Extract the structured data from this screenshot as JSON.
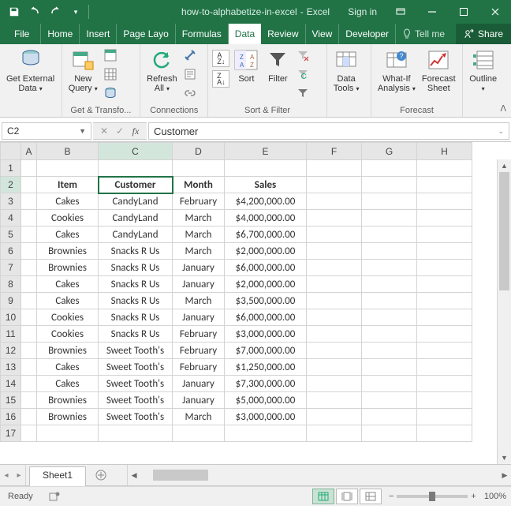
{
  "title": {
    "filename": "how-to-alphabetize-in-excel",
    "app": "Excel",
    "signin": "Sign in"
  },
  "tabs": {
    "list": [
      "File",
      "Home",
      "Insert",
      "Page Layo",
      "Formulas",
      "Data",
      "Review",
      "View",
      "Developer"
    ],
    "active": "Data",
    "tellme": "Tell me",
    "share": "Share"
  },
  "ribbon": {
    "groups": [
      {
        "label": "",
        "big": [
          {
            "name": "get-external-data",
            "text": "Get External\nData"
          }
        ]
      },
      {
        "label": "Get & Transfo...",
        "big": [
          {
            "name": "new-query",
            "text": "New\nQuery"
          }
        ],
        "smalls": 3
      },
      {
        "label": "Connections",
        "big": [
          {
            "name": "refresh-all",
            "text": "Refresh\nAll"
          }
        ],
        "smalls": 3
      },
      {
        "label": "Sort & Filter",
        "big": [
          {
            "name": "sort",
            "text": "Sort"
          },
          {
            "name": "filter",
            "text": "Filter"
          }
        ],
        "sortAZ": true,
        "filterSmalls": 3
      },
      {
        "label": "",
        "big": [
          {
            "name": "data-tools",
            "text": "Data\nTools"
          }
        ]
      },
      {
        "label": "Forecast",
        "big": [
          {
            "name": "what-if-analysis",
            "text": "What-If\nAnalysis"
          },
          {
            "name": "forecast-sheet",
            "text": "Forecast\nSheet"
          }
        ]
      },
      {
        "label": "",
        "big": [
          {
            "name": "outline",
            "text": "Outline"
          }
        ]
      }
    ]
  },
  "namebox": "C2",
  "formula": "Customer",
  "columns": [
    "A",
    "B",
    "C",
    "D",
    "E",
    "F",
    "G",
    "H"
  ],
  "activeCell": {
    "row": 2,
    "col": "C"
  },
  "headersRow": {
    "B": "Item",
    "C": "Customer",
    "D": "Month",
    "E": "Sales"
  },
  "rows": [
    {
      "n": 1
    },
    {
      "n": 2,
      "headers": true
    },
    {
      "n": 3,
      "B": "Cakes",
      "C": "CandyLand",
      "D": "February",
      "E": "$4,200,000.00"
    },
    {
      "n": 4,
      "B": "Cookies",
      "C": "CandyLand",
      "D": "March",
      "E": "$4,000,000.00"
    },
    {
      "n": 5,
      "B": "Cakes",
      "C": "CandyLand",
      "D": "March",
      "E": "$6,700,000.00"
    },
    {
      "n": 6,
      "B": "Brownies",
      "C": "Snacks R Us",
      "D": "March",
      "E": "$2,000,000.00"
    },
    {
      "n": 7,
      "B": "Brownies",
      "C": "Snacks R Us",
      "D": "January",
      "E": "$6,000,000.00"
    },
    {
      "n": 8,
      "B": "Cakes",
      "C": "Snacks R Us",
      "D": "January",
      "E": "$2,000,000.00"
    },
    {
      "n": 9,
      "B": "Cakes",
      "C": "Snacks R Us",
      "D": "March",
      "E": "$3,500,000.00"
    },
    {
      "n": 10,
      "B": "Cookies",
      "C": "Snacks R Us",
      "D": "January",
      "E": "$6,000,000.00"
    },
    {
      "n": 11,
      "B": "Cookies",
      "C": "Snacks R Us",
      "D": "February",
      "E": "$3,000,000.00"
    },
    {
      "n": 12,
      "B": "Brownies",
      "C": "Sweet Tooth's",
      "D": "February",
      "E": "$7,000,000.00"
    },
    {
      "n": 13,
      "B": "Cakes",
      "C": "Sweet Tooth's",
      "D": "February",
      "E": "$1,250,000.00"
    },
    {
      "n": 14,
      "B": "Cakes",
      "C": "Sweet Tooth's",
      "D": "January",
      "E": "$7,300,000.00"
    },
    {
      "n": 15,
      "B": "Brownies",
      "C": "Sweet Tooth's",
      "D": "January",
      "E": "$5,000,000.00"
    },
    {
      "n": 16,
      "B": "Brownies",
      "C": "Sweet Tooth's",
      "D": "March",
      "E": "$3,000,000.00"
    },
    {
      "n": 17
    }
  ],
  "sheetTabs": {
    "active": "Sheet1"
  },
  "status": {
    "ready": "Ready",
    "zoom": "100%"
  }
}
